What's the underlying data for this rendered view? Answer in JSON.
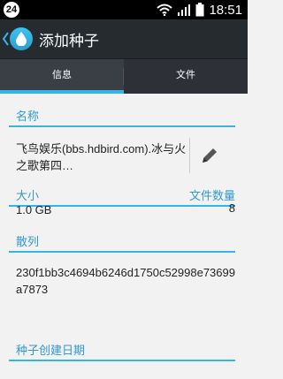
{
  "statusbar": {
    "badge": "24",
    "time": "18:51"
  },
  "actionbar": {
    "title": "添加种子"
  },
  "tabs": [
    {
      "label": "信息",
      "active": true
    },
    {
      "label": "文件",
      "active": false
    }
  ],
  "fields": {
    "name_label": "名称",
    "name_value": "飞鸟娱乐(bbs.hdbird.com).冰与火之歌第四…",
    "size_label": "大小",
    "size_value": "1.0 GB",
    "file_count_label": "文件数量",
    "file_count_value": "8",
    "hash_label": "散列",
    "hash_value": "230f1bb3c4694b6246d1750c52998e73699a7873",
    "created_label": "种子创建日期"
  },
  "colors": {
    "accent": "#33b5e5",
    "section_text": "#3399cc",
    "actionbar_bg": "#262b30",
    "tabs_bg": "#2d3137",
    "content_bg": "#f2f2f2"
  },
  "icons": {
    "status_badge": "notification-count-icon",
    "wifi": "wifi-icon",
    "signal": "signal-icon",
    "battery": "battery-icon",
    "back": "back-chevron-icon",
    "app": "water-drop-icon",
    "edit": "pencil-icon"
  }
}
